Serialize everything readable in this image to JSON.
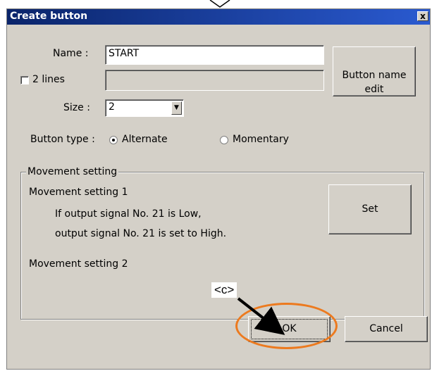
{
  "dialog": {
    "title": "Create button",
    "close_label": "x"
  },
  "form": {
    "name_label": "Name :",
    "name_value": "START",
    "two_lines_label": "2 lines",
    "two_lines_checked": false,
    "second_line_value": "",
    "size_label": "Size :",
    "size_value": "2",
    "button_name_edit_label": "Button name\nedit",
    "button_type_label": "Button type :",
    "radio_alternate_label": "Alternate",
    "radio_alternate_selected": true,
    "radio_momentary_label": "Momentary",
    "radio_momentary_selected": false
  },
  "movement": {
    "group_label": "Movement setting",
    "setting1_label": "Movement setting 1",
    "setting1_line1": "If output signal No. 21 is Low,",
    "setting1_line2": "output signal No. 21 is set to High.",
    "setting2_label": "Movement setting 2",
    "set_button_label": "Set"
  },
  "footer": {
    "ok_label": "OK",
    "cancel_label": "Cancel"
  },
  "annotation": {
    "callout_text": "<c>",
    "highlight_color": "#ec7a1f"
  },
  "colors": {
    "dialog_bg": "#d4d0c8",
    "titlebar": "#0a246a"
  }
}
